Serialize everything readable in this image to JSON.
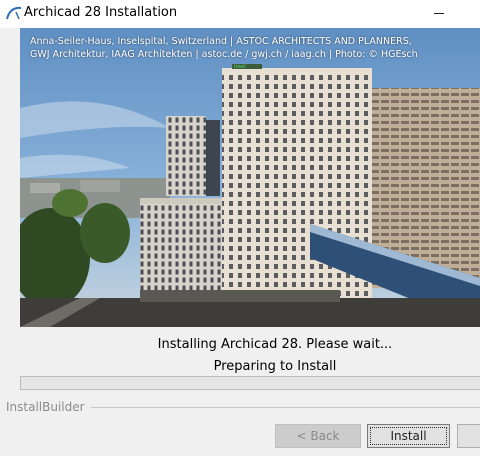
{
  "window": {
    "title": "Archicad 28 Installation"
  },
  "hero": {
    "caption_line1": "Anna-Seiler-Haus, Inselspital, Switzerland | ASTOC ARCHITECTS AND PLANNERS,",
    "caption_line2": "GWJ Architektur, IAAG Architekten | astoc.de / gwj.ch / iaag.ch | Photo: © HGEsch",
    "rooftop_sign": "Insel"
  },
  "status": {
    "main": "Installing Archicad 28. Please wait...",
    "sub": "Preparing to Install",
    "progress": 0
  },
  "footer": {
    "brand": "InstallBuilder"
  },
  "buttons": {
    "back": "< Back",
    "install": "Install"
  },
  "colors": {
    "sky": "#6f9cc9",
    "progress_fill": "#06b025",
    "disabled_button": "#cccccc"
  }
}
